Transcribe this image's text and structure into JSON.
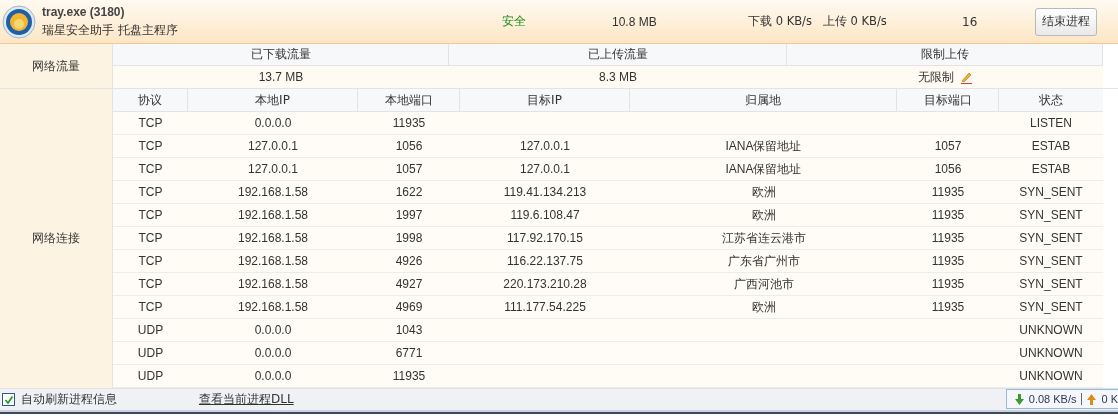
{
  "process": {
    "name": "tray.exe (3180)",
    "description": "瑞星安全助手 托盘主程序",
    "safety": "安全",
    "memory": "10.8 MB",
    "speed": "下载 0 KB/s   上传 0 KB/s",
    "count": "16",
    "end_button": "结束进程"
  },
  "traffic": {
    "label": "网络流量",
    "columns": [
      "已下载流量",
      "已上传流量",
      "限制上传"
    ],
    "values": [
      "13.7 MB",
      "8.3 MB",
      "无限制"
    ]
  },
  "connections": {
    "label": "网络连接",
    "columns": [
      "协议",
      "本地IP",
      "本地端口",
      "目标IP",
      "归属地",
      "目标端口",
      "状态"
    ],
    "rows": [
      [
        "TCP",
        "0.0.0.0",
        "11935",
        "",
        "",
        "",
        "LISTEN"
      ],
      [
        "TCP",
        "127.0.0.1",
        "1056",
        "127.0.0.1",
        "IANA保留地址",
        "1057",
        "ESTAB"
      ],
      [
        "TCP",
        "127.0.0.1",
        "1057",
        "127.0.0.1",
        "IANA保留地址",
        "1056",
        "ESTAB"
      ],
      [
        "TCP",
        "192.168.1.58",
        "1622",
        "119.41.134.213",
        "欧洲",
        "11935",
        "SYN_SENT"
      ],
      [
        "TCP",
        "192.168.1.58",
        "1997",
        "119.6.108.47",
        "欧洲",
        "11935",
        "SYN_SENT"
      ],
      [
        "TCP",
        "192.168.1.58",
        "1998",
        "117.92.170.15",
        "江苏省连云港市",
        "11935",
        "SYN_SENT"
      ],
      [
        "TCP",
        "192.168.1.58",
        "4926",
        "116.22.137.75",
        "广东省广州市",
        "11935",
        "SYN_SENT"
      ],
      [
        "TCP",
        "192.168.1.58",
        "4927",
        "220.173.210.28",
        "广西河池市",
        "11935",
        "SYN_SENT"
      ],
      [
        "TCP",
        "192.168.1.58",
        "4969",
        "111.177.54.225",
        "欧洲",
        "11935",
        "SYN_SENT"
      ],
      [
        "UDP",
        "0.0.0.0",
        "1043",
        "",
        "",
        "",
        "UNKNOWN"
      ],
      [
        "UDP",
        "0.0.0.0",
        "6771",
        "",
        "",
        "",
        "UNKNOWN"
      ],
      [
        "UDP",
        "0.0.0.0",
        "11935",
        "",
        "",
        "",
        "UNKNOWN"
      ]
    ]
  },
  "footer": {
    "auto_refresh": {
      "label": "自动刷新进程信息",
      "checked": true
    },
    "dll_link": "查看当前进程DLL",
    "speed_down": "0.08 KB/s",
    "speed_up": "0 K"
  }
}
